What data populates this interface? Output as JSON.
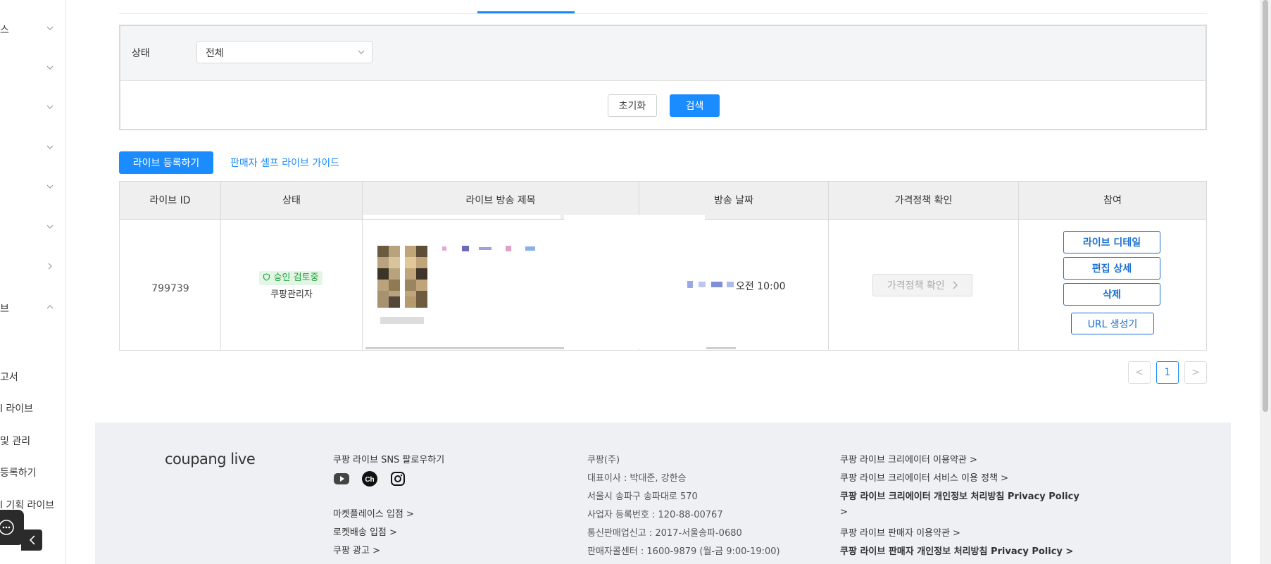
{
  "sidebar": {
    "menu_partials": [
      "스",
      "",
      "",
      "",
      "",
      "",
      "",
      "브"
    ],
    "sub_items": [
      "고서",
      "l 라이브",
      "및 관리",
      "등록하기",
      "l 기획 라이브"
    ]
  },
  "filter": {
    "status_label": "상태",
    "status_value": "전체",
    "reset_label": "초기화",
    "search_label": "검색"
  },
  "actions": {
    "register_label": "라이브 등록하기",
    "guide_label": "판매자 셀프 라이브 가이드"
  },
  "table": {
    "headers": [
      "라이브 ID",
      "상태",
      "라이브 방송 제목",
      "방송 날짜",
      "가격정책 확인",
      "참여"
    ],
    "row": {
      "id": "799739",
      "status_badge": "승인 검토중",
      "status_sub": "쿠팡관리자",
      "date_time": "오전 10:00",
      "price_check_label": "가격정책 확인",
      "buttons": [
        "라이브 디테일",
        "편집 상세",
        "삭제",
        "URL 생성기"
      ]
    }
  },
  "pagination": {
    "current": "1",
    "prev": "<",
    "next": ">"
  },
  "footer": {
    "logo": "coupang live",
    "sns_title": "쿠팡 라이브 SNS 팔로우하기",
    "links_col1": [
      "마켓플레이스 입점 >",
      "로켓배송 입점 >",
      "쿠팡 광고 >"
    ],
    "company": [
      "쿠팡(주)",
      "대표이사 : 박대준, 강한승",
      "서울시 송파구 송파대로 570",
      "사업자 등록번호 : 120-88-00767",
      "통신판매업신고 : 2017-서울송파-0680",
      "판매자콜센터 : 1600-9879 (월-금 9:00-19:00)"
    ],
    "links_col3": [
      "쿠팡 라이브 크리에이터 이용약관 >",
      "쿠팡 라이브 크리에이터 서비스 이용 정책 >",
      "쿠팡 라이브 크리에이터 개인정보 처리방침 Privacy Policy",
      ">",
      "쿠팡 라이브 판매자 이용약관 >",
      "쿠팡 라이브 판매자 개인정보 처리방침 Privacy Policy >"
    ]
  },
  "colors": {
    "accent": "#1a8cff",
    "badge_green": "#21a03a",
    "footer_bg": "#eef0f3"
  }
}
